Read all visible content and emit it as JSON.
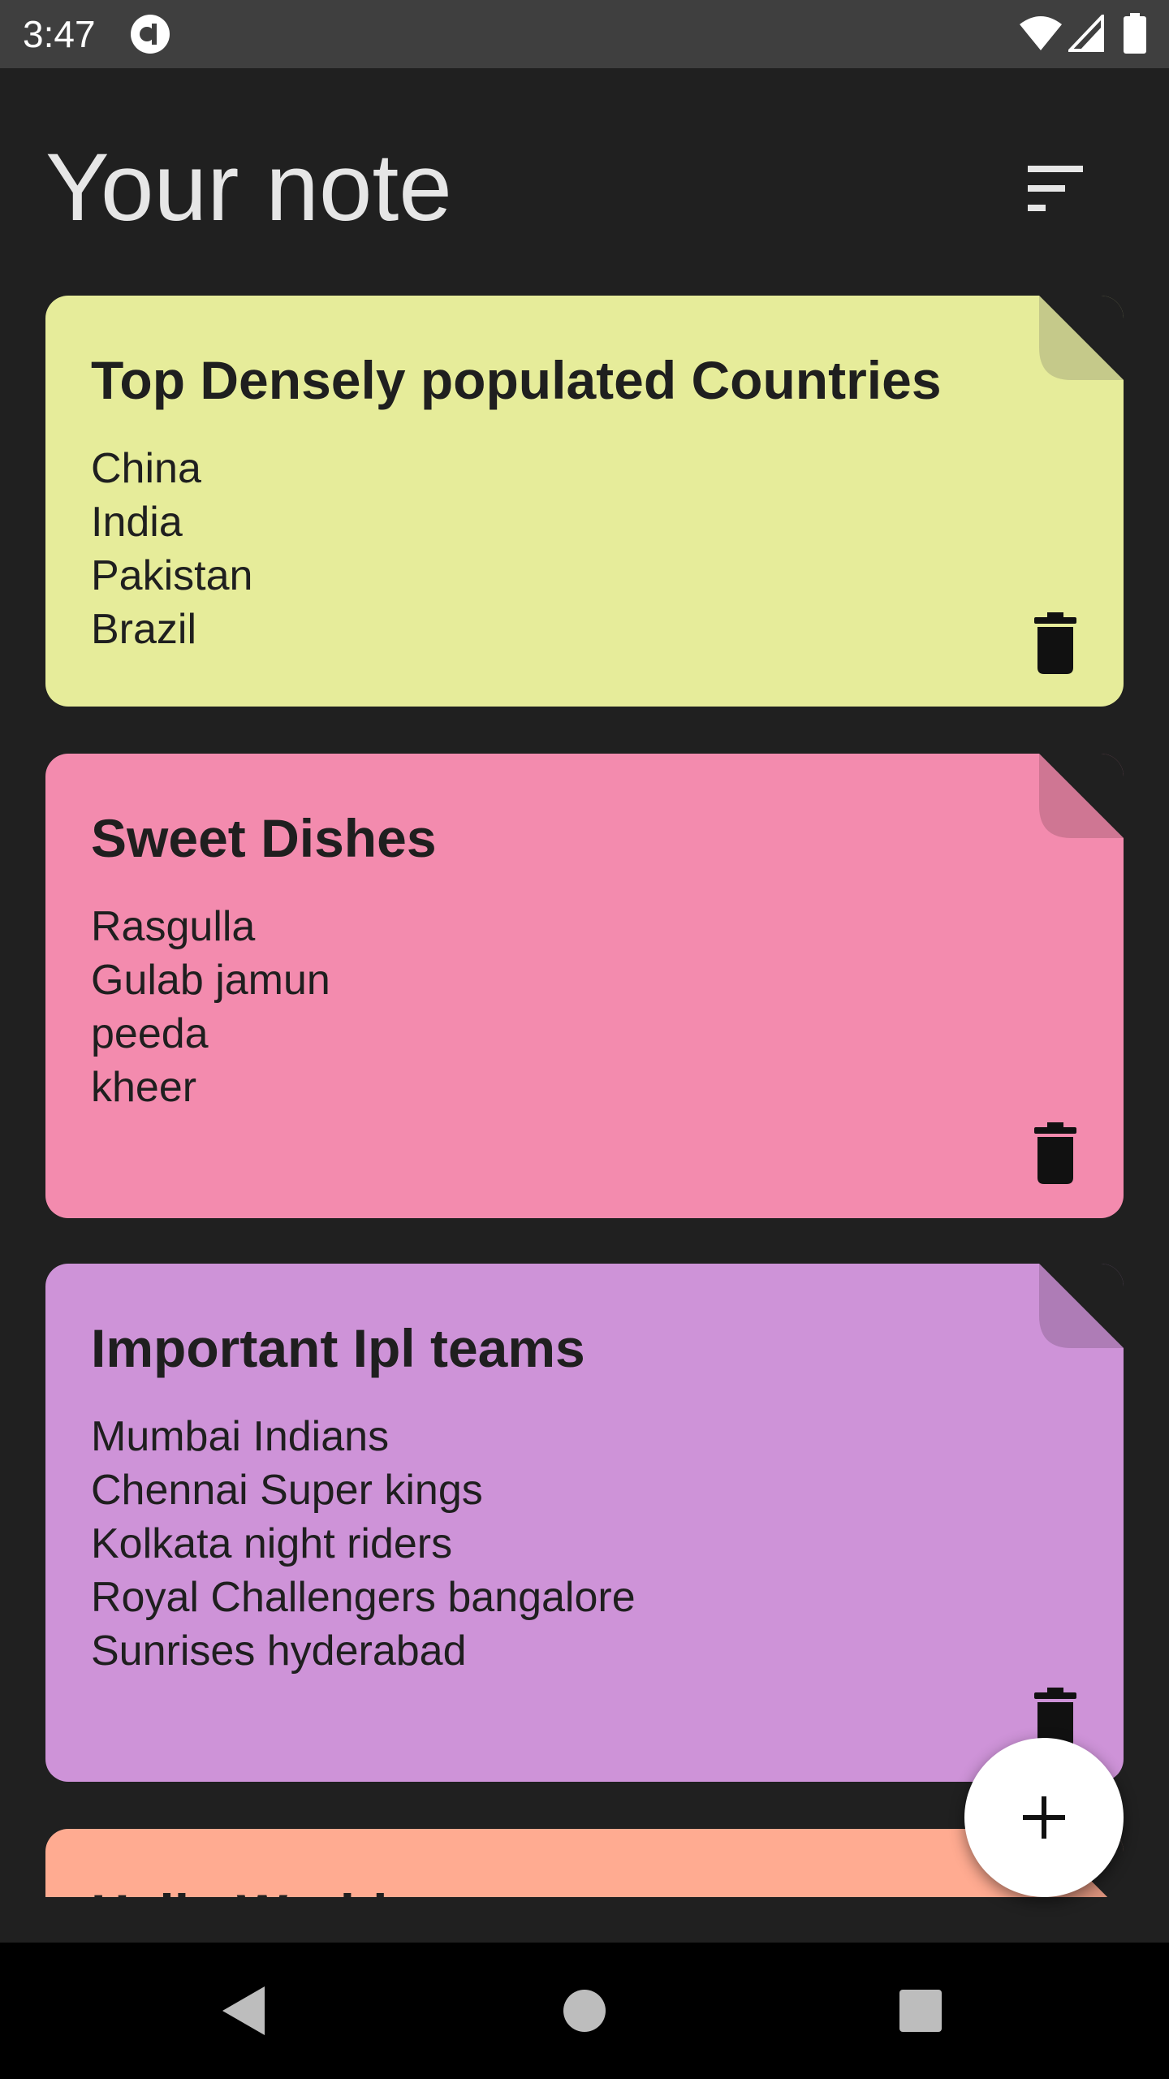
{
  "status_bar": {
    "time": "3:47",
    "icons": [
      "app-notification-icon",
      "wifi-icon",
      "cell-signal-icon",
      "battery-icon"
    ]
  },
  "header": {
    "title": "Your note",
    "sort_icon": "sort-icon"
  },
  "notes": [
    {
      "title": "Top Densely populated Countries",
      "lines": [
        "China",
        "India",
        "Pakistan",
        "Brazil"
      ],
      "color": "#e6ec9a",
      "corner_color": "#c5c98a",
      "delete_icon": "trash-icon"
    },
    {
      "title": "Sweet Dishes",
      "lines": [
        "Rasgulla",
        "Gulab jamun",
        "peeda",
        "kheer"
      ],
      "color": "#f38bae",
      "corner_color": "#cf7693",
      "delete_icon": "trash-icon"
    },
    {
      "title": "Important Ipl teams",
      "lines": [
        "Mumbai Indians",
        "Chennai Super kings",
        "Kolkata night riders",
        "Royal Challengers bangalore",
        "Sunrises hyderabad"
      ],
      "color": "#ce93d8",
      "corner_color": "#ae7cb6",
      "delete_icon": "trash-icon"
    },
    {
      "title": "Hello World",
      "lines": [],
      "color": "#ffab91",
      "corner_color": "#d9917b",
      "delete_icon": "trash-icon"
    }
  ],
  "fab": {
    "icon": "plus-icon",
    "color": "#ffffff"
  },
  "nav_bar": {
    "icons": [
      "back-icon",
      "home-icon",
      "recents-icon"
    ]
  },
  "colors": {
    "background": "#202020",
    "status_bar": "#3f3f3f",
    "title_text": "#e6e6e6"
  }
}
